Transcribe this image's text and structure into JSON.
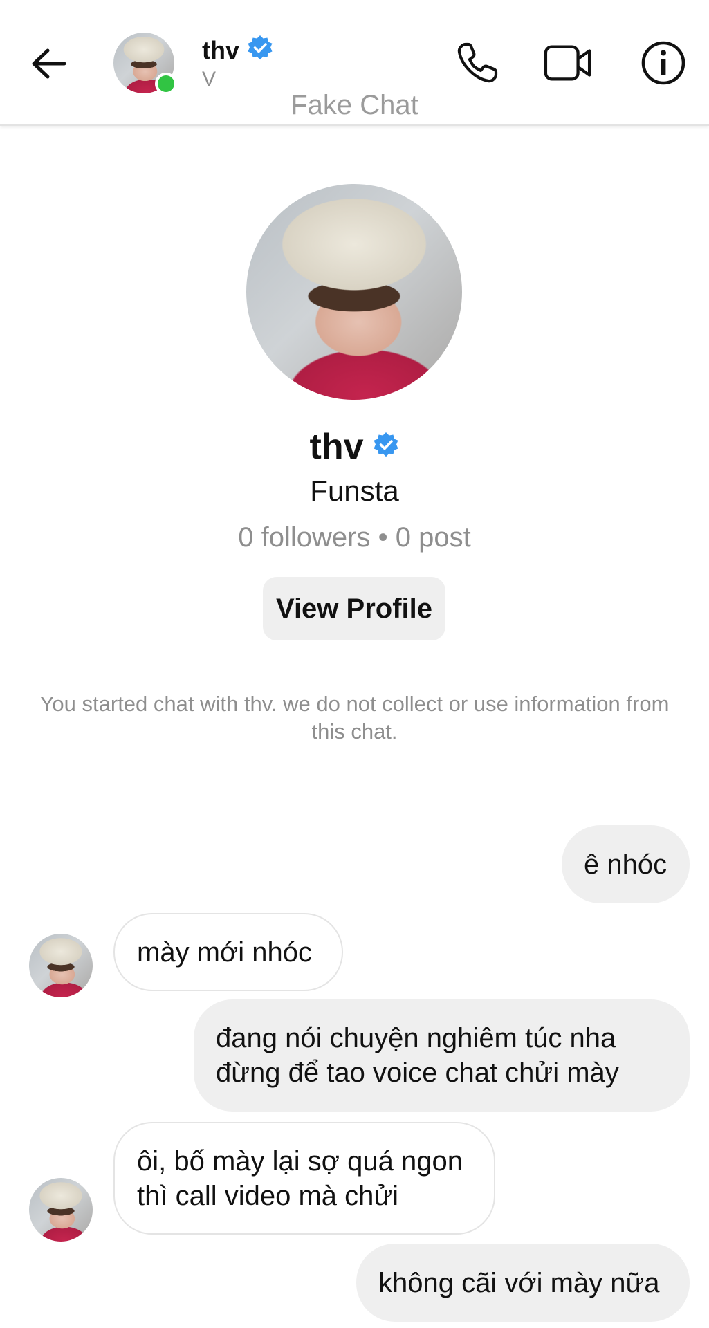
{
  "header": {
    "name": "thv",
    "subtitle": "V",
    "watermark": "Fake Chat",
    "icons": [
      "back-arrow-icon",
      "verified-icon",
      "phone-icon",
      "video-camera-icon",
      "info-icon"
    ],
    "online_status_color": "#31c443"
  },
  "profile": {
    "name": "thv",
    "type": "Funsta",
    "stats": "0 followers • 0 post",
    "view_profile_label": "View Profile"
  },
  "notice": "You started chat with thv. we do not collect or use information from this chat.",
  "messages": [
    {
      "direction": "outgoing",
      "lines": [
        "ê nhóc"
      ]
    },
    {
      "direction": "incoming",
      "lines": [
        "mày mới nhóc"
      ]
    },
    {
      "direction": "outgoing",
      "lines": [
        "đang nói chuyện nghiêm túc nha",
        "đừng để tao voice chat chửi mày"
      ]
    },
    {
      "direction": "incoming",
      "lines": [
        "ôi, bố mày lại sợ quá ngon",
        "thì call video mà chửi"
      ]
    },
    {
      "direction": "outgoing",
      "lines": [
        "không cãi với mày nữa"
      ]
    }
  ],
  "colors": {
    "verified_blue": "#3897f0",
    "outgoing_bubble": "#efefef",
    "secondary_text": "#8e8e8e"
  }
}
